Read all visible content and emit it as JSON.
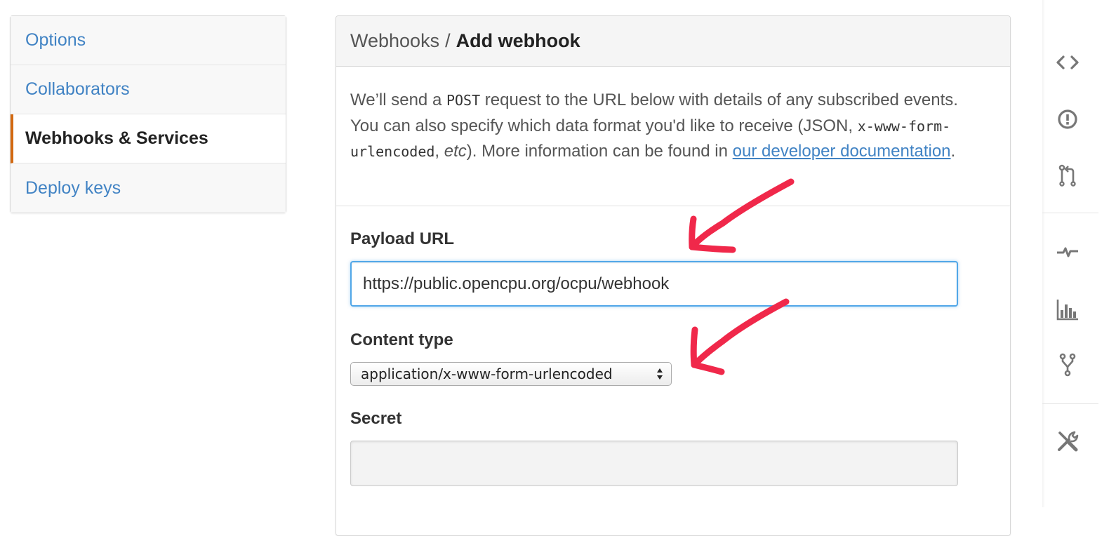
{
  "sidebar": {
    "items": [
      {
        "label": "Options"
      },
      {
        "label": "Collaborators"
      },
      {
        "label": "Webhooks & Services"
      },
      {
        "label": "Deploy keys"
      }
    ],
    "selected_index": 2,
    "accent_color": "#d26911",
    "link_color": "#4183c4"
  },
  "panel": {
    "breadcrumb_parent": "Webhooks",
    "breadcrumb_separator": "/",
    "title": "Add webhook",
    "intro": {
      "part1": "We’ll send a ",
      "code1": "POST",
      "part2": " request to the URL below with details of any subscribed events. You can also specify which data format you'd like to receive (JSON, ",
      "code2": "x-www-form-urlencoded",
      "part3": ", ",
      "em": "etc",
      "part4": "). More information can be found in ",
      "link": "our developer documentation",
      "part5": "."
    },
    "payload_url": {
      "label": "Payload URL",
      "value": "https://public.opencpu.org/ocpu/webhook"
    },
    "content_type": {
      "label": "Content type",
      "value": "application/x-www-form-urlencoded"
    },
    "secret": {
      "label": "Secret",
      "value": ""
    }
  },
  "repo_nav": {
    "icons": [
      "code-icon",
      "issues-icon",
      "pull-request-icon",
      "pulse-icon",
      "graphs-icon",
      "network-icon",
      "settings-icon"
    ]
  },
  "annotation_color": "#f0284a"
}
